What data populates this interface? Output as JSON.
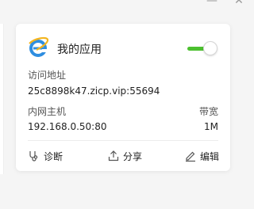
{
  "window": {
    "minimize_symbol": "—",
    "close_symbol": "✕"
  },
  "app": {
    "name": "我的应用",
    "icon": "internet-explorer-icon",
    "enabled": true,
    "toggle_color": "#4cc02f"
  },
  "fields": {
    "address_label": "访问地址",
    "address_value": "25c8898k47.zicp.vip:55694",
    "host_label": "内网主机",
    "host_value": "192.168.0.50:80",
    "bandwidth_label": "带宽",
    "bandwidth_value": "1M"
  },
  "actions": {
    "diagnose_label": "诊断",
    "share_label": "分享",
    "edit_label": "编辑"
  }
}
